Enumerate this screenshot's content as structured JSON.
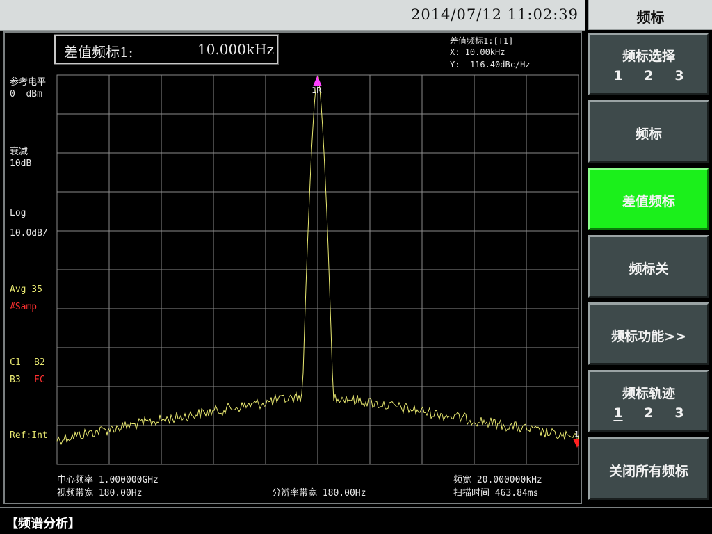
{
  "header": {
    "datetime": "2014/07/12   11:02:39"
  },
  "menu": {
    "title": "频标",
    "softkeys": [
      {
        "label": "频标选择",
        "options": [
          "1",
          "2",
          "3"
        ],
        "selected": "1"
      },
      {
        "label": "频标"
      },
      {
        "label": "差值频标",
        "active": true
      },
      {
        "label": "频标关"
      },
      {
        "label": "频标功能>>"
      },
      {
        "label": "频标轨迹",
        "options": [
          "1",
          "2",
          "3"
        ],
        "selected": "1"
      },
      {
        "label": "关闭所有频标"
      }
    ]
  },
  "active_function": {
    "label": "差值频标1:",
    "value": "10.000kHz"
  },
  "marker_readout": {
    "title": "差值频标1:[T1]",
    "x": "X: 10.00kHz",
    "y": "Y: -116.40dBc/Hz"
  },
  "left_panel": {
    "ref_level_label": "参考电平",
    "ref_level_value": "0  dBm",
    "atten_label": "衰减",
    "atten_value": "10dB",
    "scale_label": "Log",
    "scale_value": "10.0dB/",
    "avg": "Avg 35",
    "detector": "#Samp",
    "c1": "C1",
    "b2": "B2",
    "b3": "B3",
    "fc": "FC",
    "ref": "Ref:Int"
  },
  "bottom_info": {
    "center_freq": "中心频率 1.000000GHz",
    "vbw": "视频带宽 180.00Hz",
    "rbw": "分辨率带宽 180.00Hz",
    "span": "频宽 20.000000kHz",
    "sweep_time": "扫描时间 463.84ms"
  },
  "status_bar": {
    "mode": "【频谱分析】"
  },
  "markers": {
    "main_label": "1R",
    "end_label": "1"
  },
  "colors": {
    "trace": "#e8e870",
    "marker": "#ff40ff",
    "end_marker": "#ff2020",
    "grid": "#8a8a8a",
    "active_key": "#1bf01b",
    "key_bg": "#3e4a4b"
  }
}
